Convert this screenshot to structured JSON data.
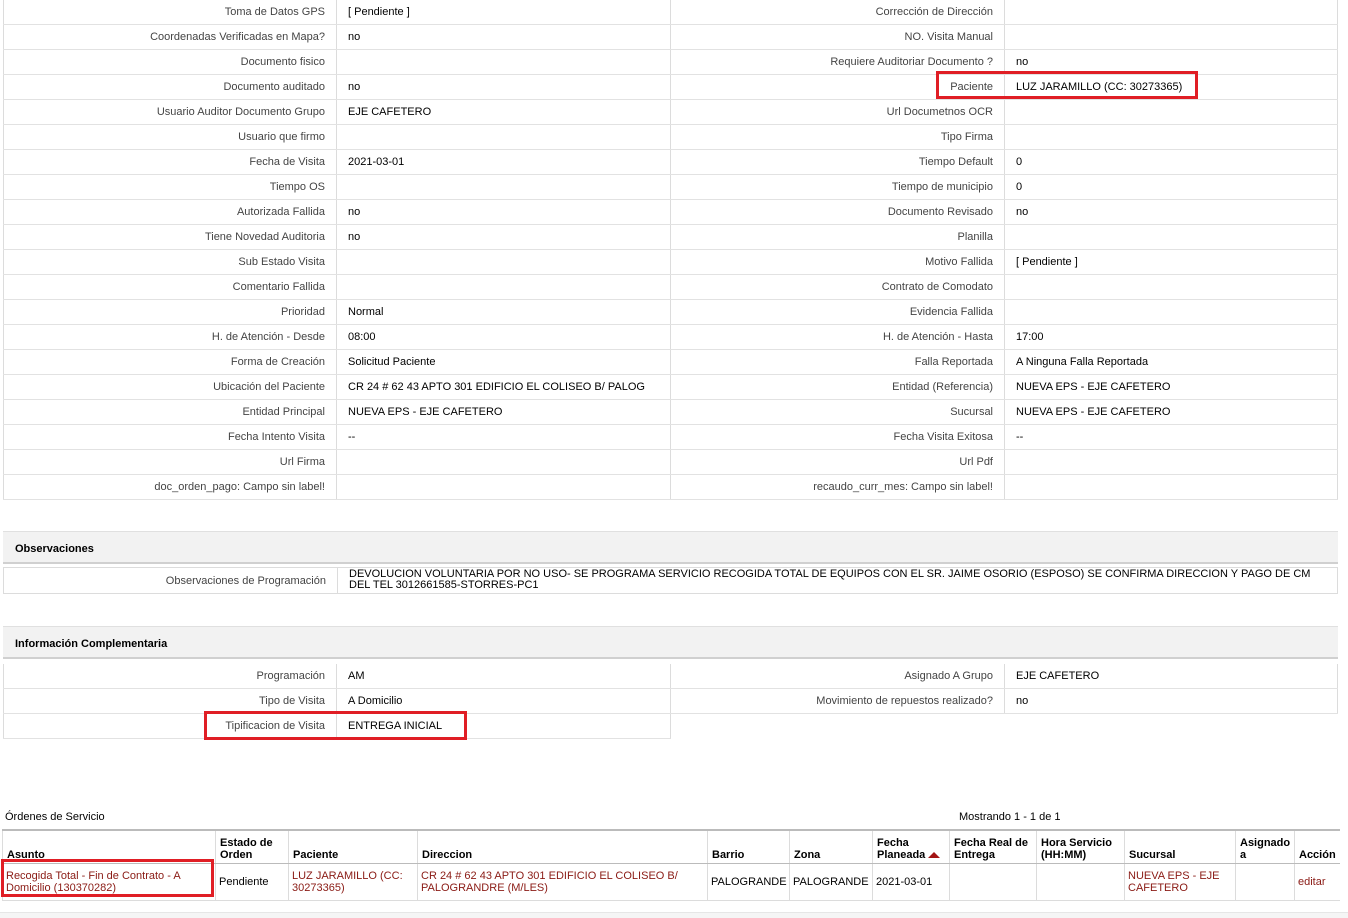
{
  "details": [
    {
      "l1": "Toma de Datos GPS",
      "v1": "[ Pendiente ]",
      "l2": "Corrección de Dirección",
      "v2": ""
    },
    {
      "l1": "Coordenadas Verificadas en Mapa?",
      "v1": "no",
      "l2": "NO. Visita Manual",
      "v2": ""
    },
    {
      "l1": "Documento fisico",
      "v1": "",
      "l2": "Requiere Auditoriar Documento ?",
      "v2": "no"
    },
    {
      "l1": "Documento auditado",
      "v1": "no",
      "l2": "Paciente",
      "v2": "LUZ JARAMILLO (CC: 30273365)"
    },
    {
      "l1": "Usuario Auditor Documento Grupo",
      "v1": "EJE CAFETERO",
      "l2": "Url Documetnos OCR",
      "v2": ""
    },
    {
      "l1": "Usuario que firmo",
      "v1": "",
      "l2": "Tipo Firma",
      "v2": ""
    },
    {
      "l1": "Fecha de Visita",
      "v1": "2021-03-01",
      "l2": "Tiempo Default",
      "v2": "0"
    },
    {
      "l1": "Tiempo OS",
      "v1": "",
      "l2": "Tiempo de municipio",
      "v2": "0"
    },
    {
      "l1": "Autorizada Fallida",
      "v1": "no",
      "l2": "Documento Revisado",
      "v2": "no"
    },
    {
      "l1": "Tiene Novedad Auditoria",
      "v1": "no",
      "l2": "Planilla",
      "v2": ""
    },
    {
      "l1": "Sub Estado Visita",
      "v1": "",
      "l2": "Motivo Fallida",
      "v2": "[ Pendiente ]"
    },
    {
      "l1": "Comentario Fallida",
      "v1": "",
      "l2": "Contrato de Comodato",
      "v2": ""
    },
    {
      "l1": "Prioridad",
      "v1": "Normal",
      "l2": "Evidencia Fallida",
      "v2": ""
    },
    {
      "l1": "H. de Atención - Desde",
      "v1": "08:00",
      "l2": "H. de Atención - Hasta",
      "v2": "17:00"
    },
    {
      "l1": "Forma de Creación",
      "v1": "Solicitud Paciente",
      "l2": "Falla Reportada",
      "v2": "A Ninguna Falla Reportada"
    },
    {
      "l1": "Ubicación del Paciente",
      "v1": "CR 24 # 62 43 APTO 301 EDIFICIO EL COLISEO B/ PALOG",
      "l2": "Entidad (Referencia)",
      "v2": "NUEVA EPS - EJE CAFETERO"
    },
    {
      "l1": "Entidad Principal",
      "v1": "NUEVA EPS - EJE CAFETERO",
      "l2": "Sucursal",
      "v2": "NUEVA EPS - EJE CAFETERO"
    },
    {
      "l1": "Fecha Intento Visita",
      "v1": "--",
      "l2": "Fecha Visita Exitosa",
      "v2": "--"
    },
    {
      "l1": "Url Firma",
      "v1": "",
      "l2": "Url Pdf",
      "v2": ""
    },
    {
      "l1": "doc_orden_pago: Campo sin label!",
      "v1": "",
      "l2": "recaudo_curr_mes: Campo sin label!",
      "v2": ""
    }
  ],
  "observaciones": {
    "title": "Observaciones",
    "label": "Observaciones de Programación",
    "value": "DEVOLUCION VOLUNTARIA POR NO USO- SE PROGRAMA SERVICIO RECOGIDA TOTAL DE EQUIPOS CON EL SR. JAIME OSORIO (ESPOSO) SE CONFIRMA DIRECCION Y PAGO DE CM DEL TEL 3012661585-STORRES-PC1"
  },
  "complementaria": {
    "title": "Información Complementaria",
    "rows": [
      {
        "l1": "Programación",
        "v1": "AM",
        "l2": "Asignado A Grupo",
        "v2": "EJE CAFETERO"
      },
      {
        "l1": "Tipo de Visita",
        "v1": "A Domicilio",
        "l2": "Movimiento de repuestos realizado?",
        "v2": "no"
      },
      {
        "l1": "Tipificacion de Visita",
        "v1": "ENTREGA INICIAL"
      }
    ]
  },
  "ordenes": {
    "title": "Órdenes de Servicio",
    "count": "Mostrando 1 - 1 de 1",
    "headers": [
      "Asunto",
      "Estado de Orden",
      "Paciente",
      "Direccion",
      "Barrio",
      "Zona",
      "Fecha Planeada",
      "Fecha Real de Entrega",
      "Hora Servicio (HH:MM)",
      "Sucursal",
      "Asignado a",
      "Acción"
    ],
    "row": {
      "asunto": "Recogida Total - Fin de Contrato - A Domicilio (130370282)",
      "estado": "Pendiente",
      "paciente": "LUZ JARAMILLO (CC: 30273365)",
      "direccion": "CR 24 # 62 43 APTO 301 EDIFICIO EL COLISEO B/ PALOGRANDRE (M/LES)",
      "barrio": "PALOGRANDE",
      "zona": "PALOGRANDE",
      "fecha": "2021-03-01",
      "fecha_real": "",
      "hora": "",
      "sucursal": "NUEVA EPS - EJE CAFETERO",
      "asignado": "",
      "accion": "editar"
    }
  }
}
